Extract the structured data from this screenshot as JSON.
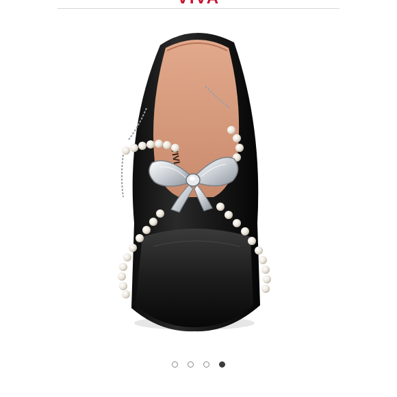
{
  "header": {
    "brand_text": "VIVA",
    "colors": {
      "brand": "#c8102e",
      "divider": "#d6d6d6"
    }
  },
  "product": {
    "insole_brand": "VIVI",
    "image": "black-mary-jane-flat-pearl-straps-crystal-bow"
  },
  "carousel": {
    "total": 4,
    "active_index": 3
  }
}
